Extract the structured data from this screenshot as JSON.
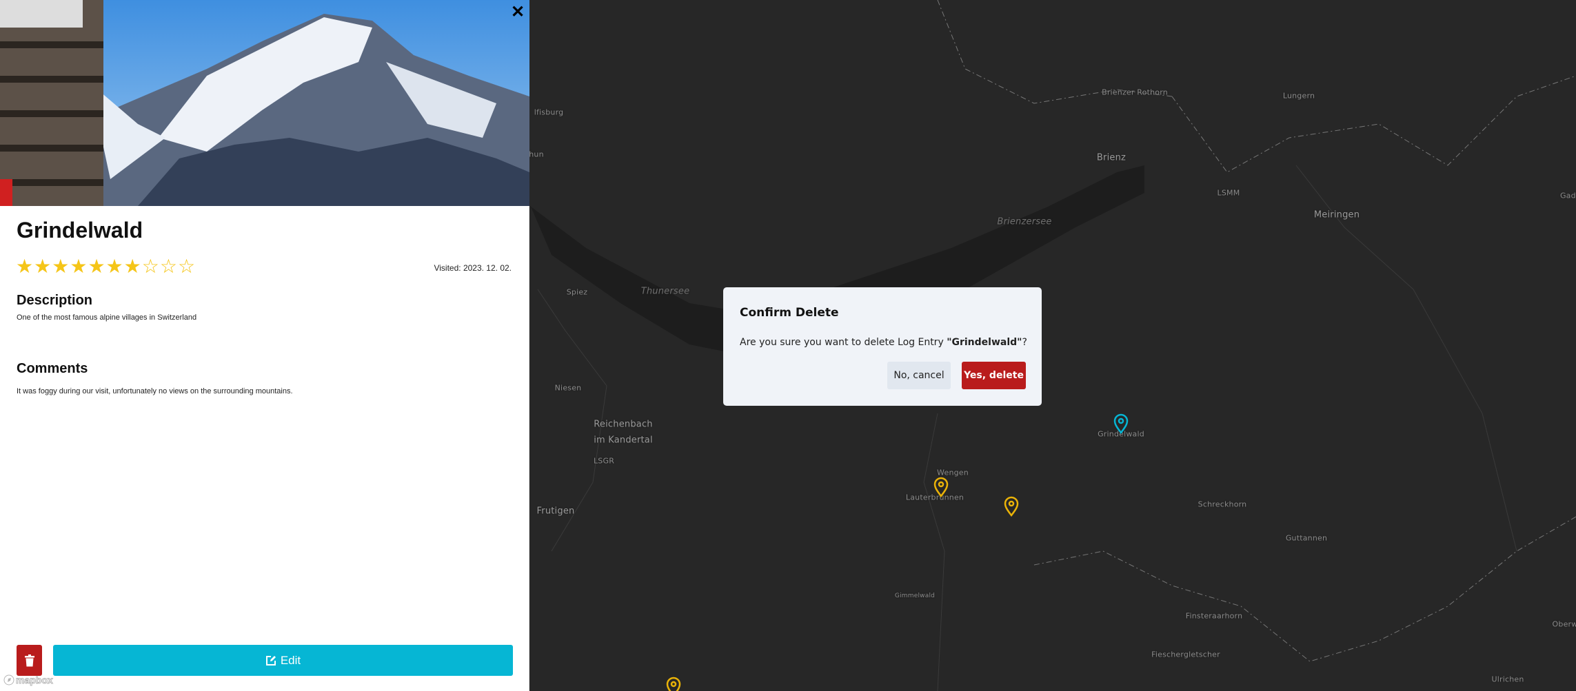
{
  "entry": {
    "title": "Grindelwald",
    "rating": 7,
    "rating_max": 10,
    "visited": "Visited: 2023. 12. 02.",
    "description_heading": "Description",
    "description": "One of the most famous alpine villages in Switzerland",
    "comments_heading": "Comments",
    "comments": "It was foggy during our visit, unfortunately no views on the surrounding mountains.",
    "edit_label": "Edit",
    "close_icon": "close-icon",
    "delete_icon": "trash-icon",
    "edit_icon": "edit-icon"
  },
  "dialog": {
    "title": "Confirm Delete",
    "message_prefix": "Are you sure you want to delete Log Entry ",
    "message_name": "\"Grindelwald\"",
    "message_suffix": "?",
    "cancel_label": "No, cancel",
    "confirm_label": "Yes, delete"
  },
  "map": {
    "attribution": "mapbox",
    "labels": [
      "lfisburg",
      "hun",
      "Brienzer Rothorn",
      "Lungern",
      "Brienz",
      "LSMM",
      "Meiringen",
      "Gadı",
      "Brienzersee",
      "Spiez",
      "Thunersee",
      "Niesen",
      "Reichenbach",
      "im Kandertal",
      "LSGR",
      "Frutigen",
      "Wengen",
      "Lauterbrunnen",
      "Grindelwald",
      "Schreckhorn",
      "Guttannen",
      "Gimmelwald",
      "Finsteraarhorn",
      "Fieschergletscher",
      "Oberw",
      "Ulrichen"
    ],
    "markers": [
      {
        "label": "Grindelwald",
        "color": "#06b6d4",
        "selected": true
      },
      {
        "label": "Lauterbrunnen",
        "color": "#eab308"
      },
      {
        "label": "",
        "color": "#eab308"
      },
      {
        "label": "",
        "color": "#eab308"
      }
    ]
  },
  "colors": {
    "accent": "#06b6d4",
    "danger": "#b91c1c",
    "star": "#f5c518",
    "marker": "#eab308"
  }
}
